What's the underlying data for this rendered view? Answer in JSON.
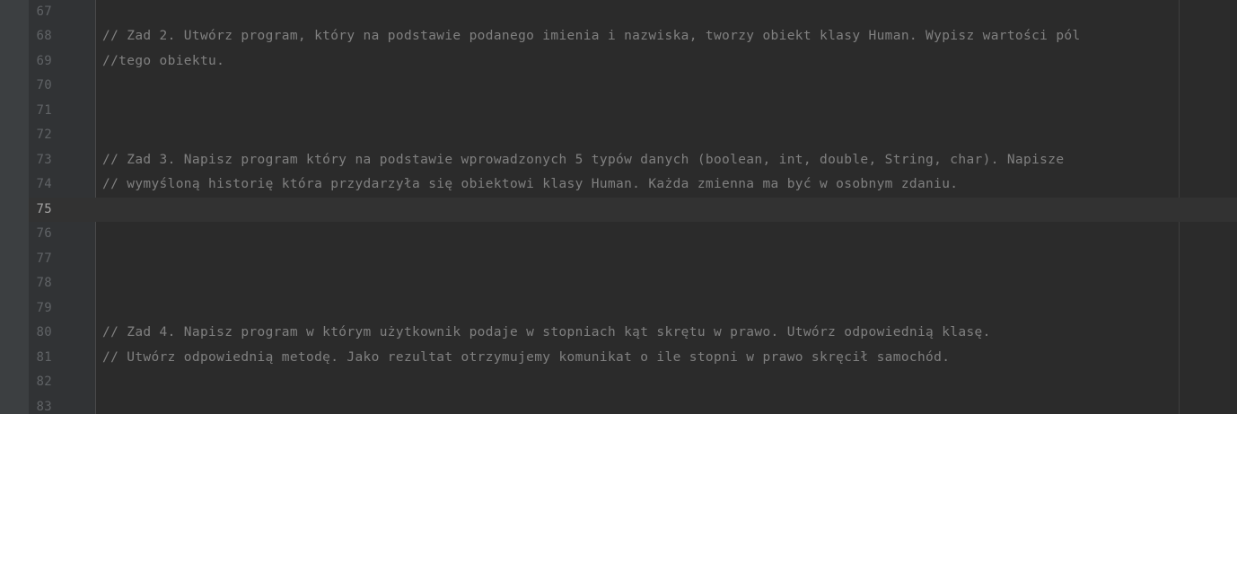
{
  "editor": {
    "current_line": "75",
    "lines": [
      {
        "num": "67",
        "text": ""
      },
      {
        "num": "68",
        "text": "// Zad 2. Utwórz program, który na podstawie podanego imienia i nazwiska, tworzy obiekt klasy Human. Wypisz wartości pól"
      },
      {
        "num": "69",
        "text": "//tego obiektu."
      },
      {
        "num": "70",
        "text": ""
      },
      {
        "num": "71",
        "text": ""
      },
      {
        "num": "72",
        "text": ""
      },
      {
        "num": "73",
        "text": "// Zad 3. Napisz program który na podstawie wprowadzonych 5 typów danych (boolean, int, double, String, char). Napisze"
      },
      {
        "num": "74",
        "text": "// wymyśloną historię która przydarzyła się obiektowi klasy Human. Każda zmienna ma być w osobnym zdaniu."
      },
      {
        "num": "75",
        "text": ""
      },
      {
        "num": "76",
        "text": ""
      },
      {
        "num": "77",
        "text": ""
      },
      {
        "num": "78",
        "text": ""
      },
      {
        "num": "79",
        "text": ""
      },
      {
        "num": "80",
        "text": "// Zad 4. Napisz program w którym użytkownik podaje w stopniach kąt skrętu w prawo. Utwórz odpowiednią klasę."
      },
      {
        "num": "81",
        "text": "// Utwórz odpowiednią metodę. Jako rezultat otrzymujemy komunikat o ile stopni w prawo skręcił samochód."
      },
      {
        "num": "82",
        "text": ""
      },
      {
        "num": "83",
        "text": ""
      }
    ]
  }
}
